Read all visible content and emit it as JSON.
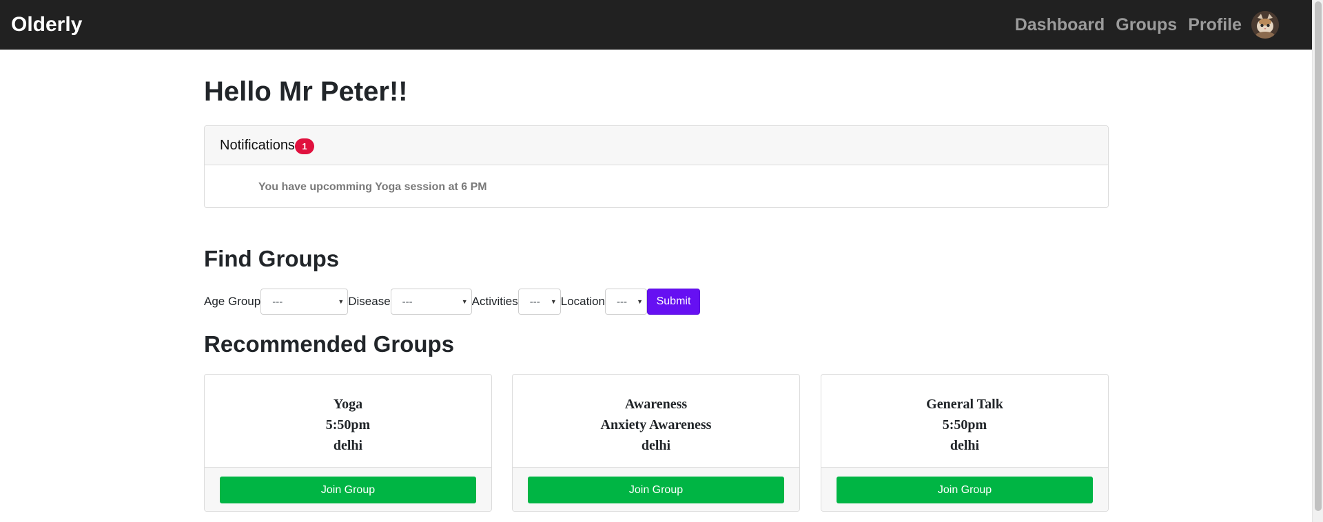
{
  "app": {
    "brand": "Olderly"
  },
  "nav": {
    "links": [
      {
        "label": "Dashboard"
      },
      {
        "label": "Groups"
      },
      {
        "label": "Profile"
      }
    ],
    "avatar_icon": "cat-avatar-icon"
  },
  "greeting": "Hello Mr Peter!!",
  "notifications": {
    "title": "Notifications",
    "count": "1",
    "items": [
      {
        "text": "You have upcomming Yoga session at 6 PM"
      }
    ]
  },
  "find_groups": {
    "title": "Find Groups",
    "filters": [
      {
        "label": "Age Group",
        "selected": "---"
      },
      {
        "label": "Disease",
        "selected": "---"
      },
      {
        "label": "Activities",
        "selected": "---"
      },
      {
        "label": "Location",
        "selected": "---"
      }
    ],
    "submit_label": "Submit"
  },
  "recommended": {
    "title": "Recommended Groups",
    "groups": [
      {
        "line1": "Yoga",
        "line2": "5:50pm",
        "line3": "delhi",
        "button": "Join Group"
      },
      {
        "line1": "Awareness",
        "line2": "Anxiety Awareness",
        "line3": "delhi",
        "button": "Join Group"
      },
      {
        "line1": "General Talk",
        "line2": "5:50pm",
        "line3": "delhi",
        "button": "Join Group"
      }
    ]
  },
  "colors": {
    "navbar": "#212121",
    "nav_link": "#9b9b9b",
    "badge": "#e0113e",
    "submit": "#6610f2",
    "join": "#00b544"
  }
}
